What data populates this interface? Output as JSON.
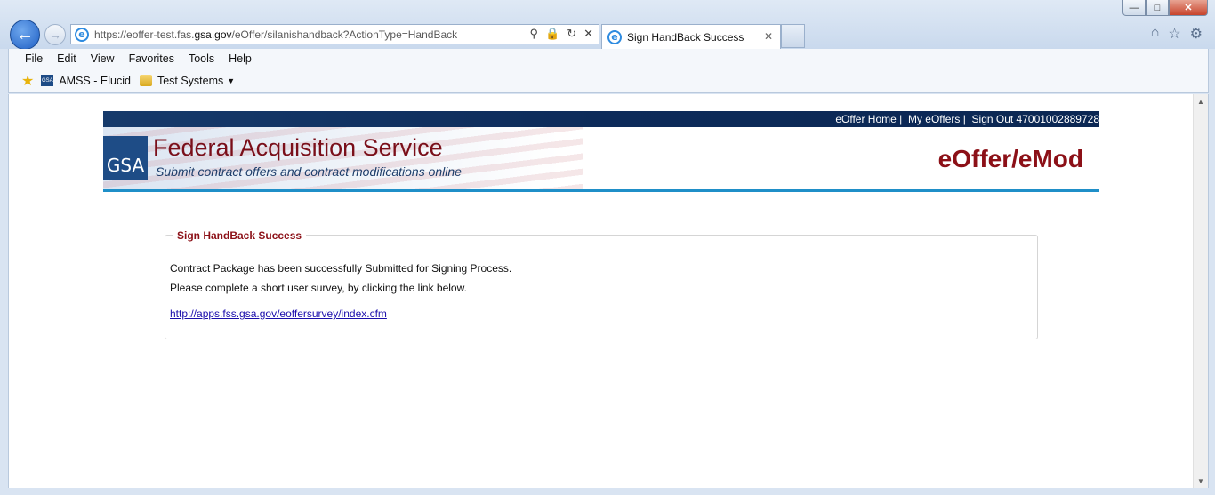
{
  "browser": {
    "url_host": "https://eoffer-test.fas.",
    "url_domain": "gsa.gov",
    "url_path": "/eOffer/silanishandback?ActionType=HandBack",
    "tab_title": "Sign HandBack Success",
    "menu": [
      "File",
      "Edit",
      "View",
      "Favorites",
      "Tools",
      "Help"
    ],
    "favorites": [
      {
        "label": "AMSS - Elucid",
        "icon": "gsa-icon"
      },
      {
        "label": "Test Systems",
        "icon": "folder-icon"
      }
    ]
  },
  "header": {
    "links": [
      "eOffer Home",
      "My eOffers",
      "Sign Out 47001002889728"
    ],
    "logo_text": "GSA",
    "org_title": "Federal Acquisition Service",
    "org_subtitle": "Submit contract offers and contract modifications online",
    "brand": "eOffer/eMod"
  },
  "content": {
    "legend": "Sign HandBack Success",
    "message1": "Contract Package has been successfully Submitted for Signing Process.",
    "message2": "Please complete a short user survey, by clicking the link below.",
    "survey_link": "http://apps.fss.gsa.gov/eoffersurvey/index.cfm"
  },
  "colors": {
    "brand_red": "#8c1017",
    "navy": "#0d2b5a",
    "rule_blue": "#1f8fc8"
  }
}
